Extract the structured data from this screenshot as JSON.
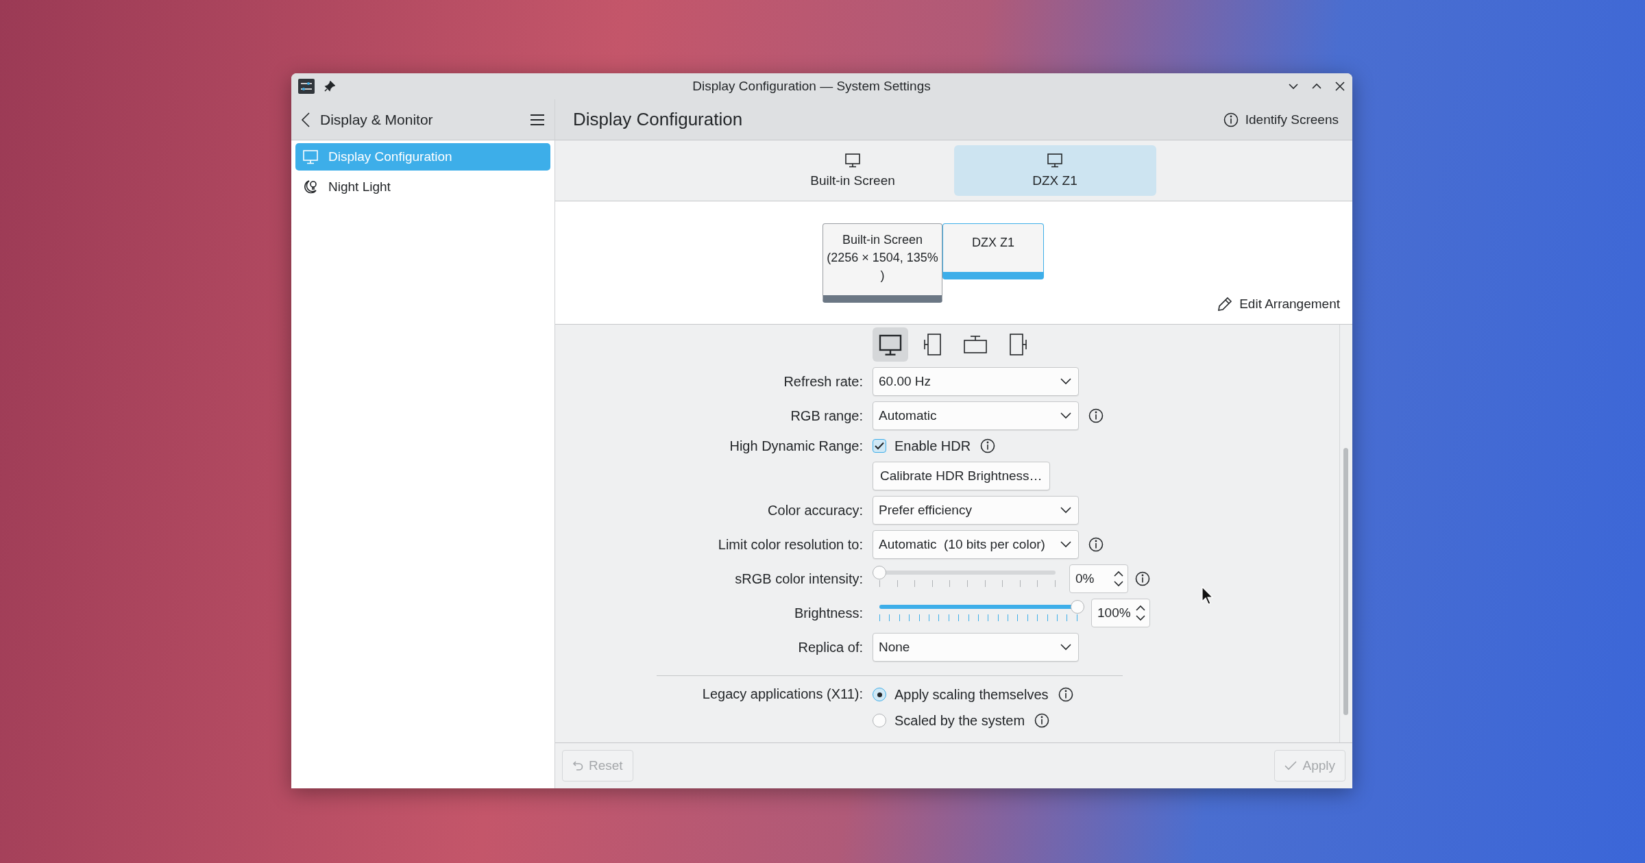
{
  "window": {
    "title": "Display Configuration — System Settings"
  },
  "sidebar": {
    "title": "Display & Monitor",
    "items": [
      {
        "label": "Display Configuration",
        "kind": "monitor",
        "selected": true
      },
      {
        "label": "Night Light",
        "kind": "night",
        "selected": false
      }
    ]
  },
  "header": {
    "title": "Display Configuration",
    "action": "Identify Screens"
  },
  "tabs": [
    {
      "label": "Built-in Screen",
      "selected": false
    },
    {
      "label": "DZX Z1",
      "selected": true
    }
  ],
  "arrangement": {
    "screens": [
      {
        "lines": [
          "Built-in Screen",
          "(2256 × 1504, 135%",
          ")"
        ],
        "selected": false
      },
      {
        "lines": [
          "DZX Z1"
        ],
        "selected": true
      }
    ],
    "edit_button": "Edit Arrangement"
  },
  "orientations": [
    {
      "kind": "normal",
      "selected": true
    },
    {
      "kind": "left",
      "selected": false
    },
    {
      "kind": "inverted",
      "selected": false
    },
    {
      "kind": "right",
      "selected": false
    }
  ],
  "form": {
    "rows": [
      {
        "kind": "combo",
        "label": "Refresh rate:",
        "value": "60.00 Hz",
        "info": false
      },
      {
        "kind": "combo",
        "label": "RGB range:",
        "value": "Automatic",
        "info": true
      },
      {
        "kind": "checkbox",
        "label": "High Dynamic Range:",
        "text": "Enable HDR",
        "checked": true,
        "info": true
      },
      {
        "kind": "button",
        "text": "Calibrate HDR Brightness…"
      },
      {
        "kind": "combo",
        "label": "Color accuracy:",
        "value": "Prefer efficiency",
        "info": false
      },
      {
        "kind": "combo",
        "label": "Limit color resolution to:",
        "value": "Automatic  (10 bits per color)",
        "info": true
      },
      {
        "kind": "slider",
        "label": "sRGB color intensity:",
        "level": 0,
        "reading": "0%",
        "info": true
      },
      {
        "kind": "slider",
        "label": "Brightness:",
        "level": 1,
        "reading": "100%",
        "info": false
      },
      {
        "kind": "combo",
        "label": "Replica of:",
        "value": "None",
        "info": false
      },
      {
        "kind": "separator"
      },
      {
        "kind": "radio",
        "label": "Legacy applications (X11):",
        "options": [
          {
            "text": "Apply scaling themselves",
            "selected": true,
            "info": true
          },
          {
            "text": "Scaled by the system",
            "selected": false,
            "info": true
          }
        ]
      }
    ]
  },
  "footer": {
    "reset": {
      "label": "Reset",
      "disabled": true
    },
    "apply": {
      "label": "Apply",
      "disabled": true
    }
  }
}
